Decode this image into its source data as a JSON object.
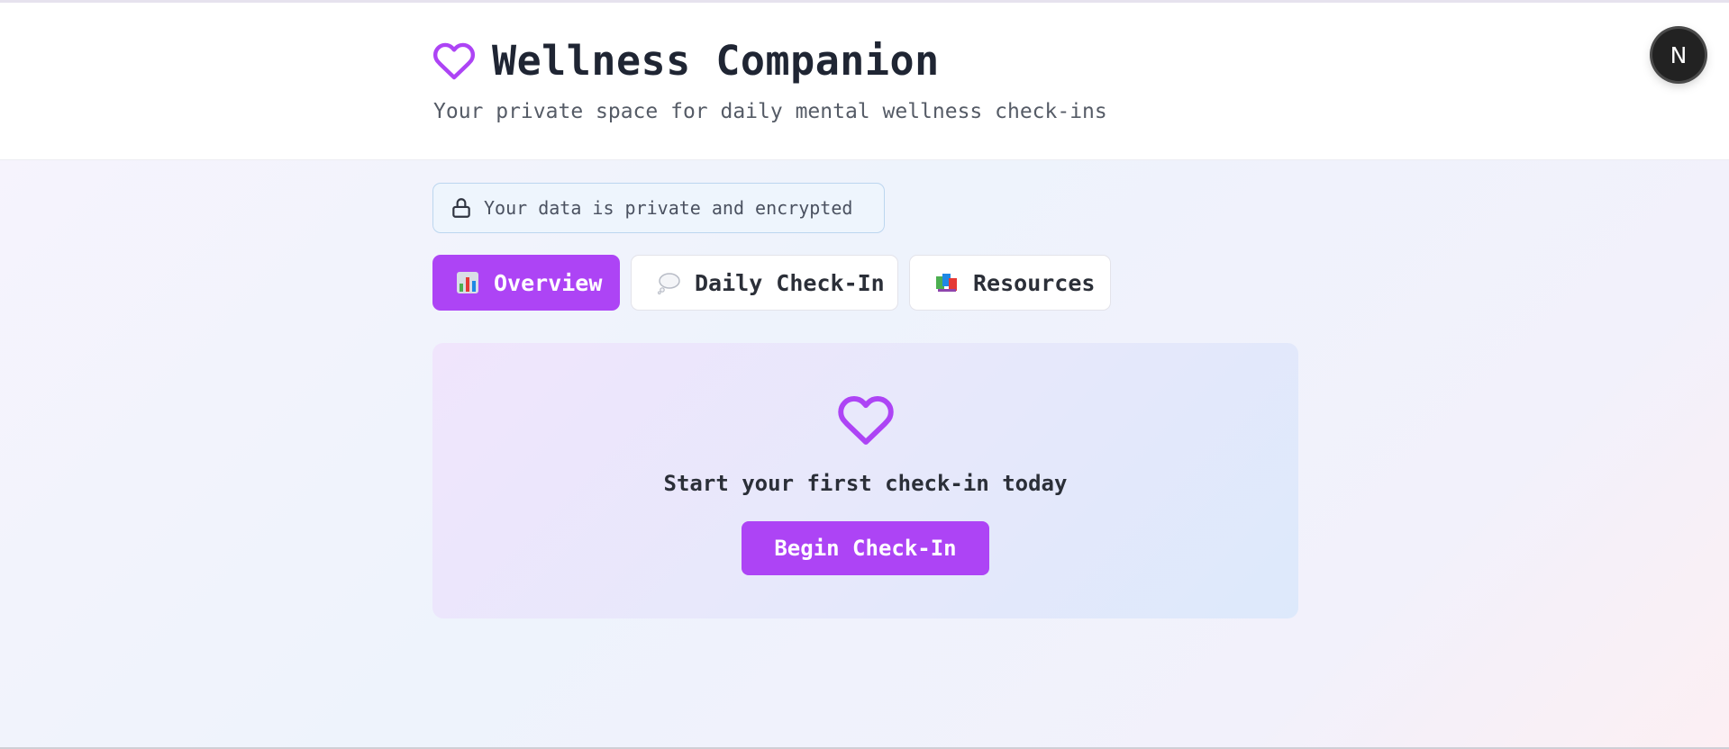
{
  "header": {
    "title": "Wellness Companion",
    "title_icon": "heart-icon",
    "subtitle": "Your private space for daily mental wellness check-ins"
  },
  "user_avatar": {
    "initial": "N"
  },
  "privacy_badge": {
    "icon": "lock-icon",
    "text": "Your data is private and encrypted"
  },
  "tabs": [
    {
      "label": "Overview",
      "icon": "bar-chart-icon",
      "active": true
    },
    {
      "label": "Daily Check-In",
      "icon": "thought-bubble-icon",
      "active": false
    },
    {
      "label": "Resources",
      "icon": "books-icon",
      "active": false
    }
  ],
  "empty_state": {
    "icon": "heart-icon",
    "message": "Start your first check-in today",
    "button_label": "Begin Check-In"
  },
  "colors": {
    "accent": "#ad44f5",
    "title_text": "#1f2533",
    "badge_background": "#eef5fd",
    "badge_border": "#bcd6ef"
  }
}
